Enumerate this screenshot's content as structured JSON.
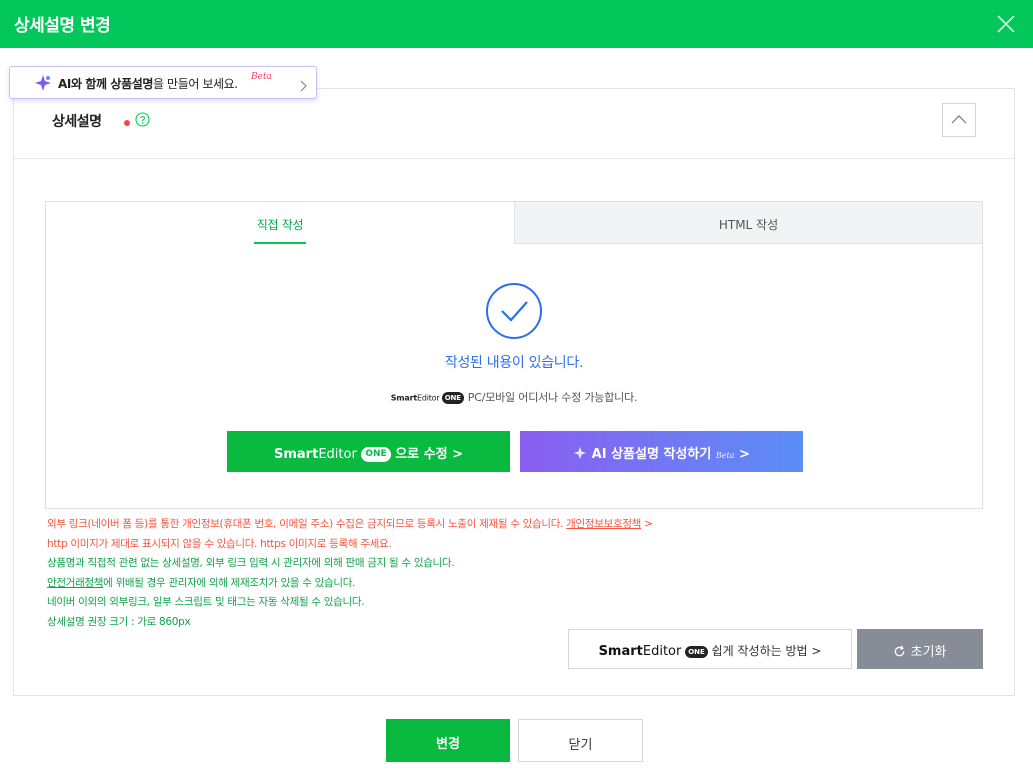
{
  "header": {
    "title": "상세설명 변경",
    "brand_color": "#03c75a"
  },
  "ai_banner": {
    "text_bold": "AI와 함께 상품설명",
    "text_rest": "을 만들어 보세요.",
    "beta": "Beta"
  },
  "section": {
    "title": "상세설명"
  },
  "tabs": [
    {
      "label": "직접 작성",
      "active": true
    },
    {
      "label": "HTML 작성",
      "active": false
    }
  ],
  "status": {
    "message": "작성된 내용이 있습니다.",
    "logo_smart": "Smart",
    "logo_editor": "Editor",
    "logo_one": "ONE",
    "info": "PC/모바일 어디서나 수정 가능합니다."
  },
  "buttons": {
    "edit_smart": "Smart",
    "edit_editor": "Editor",
    "edit_one": "ONE",
    "edit_suffix": "으로 수정 >",
    "ai": "AI 상품설명 작성하기",
    "ai_beta": "Beta",
    "ai_suffix": ">",
    "howto_smart": "Smart",
    "howto_editor": "Editor",
    "howto_one": "ONE",
    "howto_suffix": "쉽게 작성하는 방법 >",
    "reset": "초기화",
    "confirm": "변경",
    "close": "닫기"
  },
  "notes": {
    "line1_text": "외부 링크(네이버 폼 등)를 통한 개인정보(휴대폰 번호, 이메일 주소) 수집은 금지되므로 등록시 노출이 제재될 수 있습니다.",
    "line1_link": "개인정보보호정책",
    "line1_arrow": ">",
    "line2": "http 이미지가 제대로 표시되지 않을 수 있습니다. https 이미지로 등록해 주세요.",
    "line3": "상품명과 직접적 관련 없는 상세설명, 외부 링크 입력 시 관리자에 의해 판매 금지 될 수 있습니다.",
    "line4_link": "안전거래정책",
    "line4_text": "에 위배될 경우 관리자에 의해 제재조치가 있을 수 있습니다.",
    "line5": "네이버 이외의 외부링크, 일부 스크립트 및 태그는 자동 삭제될 수 있습니다.",
    "line6": "상세설명 권장 크기 : 가로 860px"
  }
}
